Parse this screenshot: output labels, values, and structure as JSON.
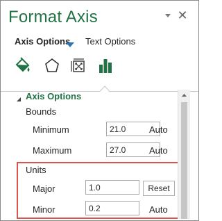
{
  "pane": {
    "title": "Format Axis",
    "close_glyph": "✕"
  },
  "tabs": [
    {
      "label": "Axis Options"
    },
    {
      "label": "Text Options"
    }
  ],
  "icons": {
    "fill": "fill-line-icon",
    "effects": "effects-icon",
    "size": "size-properties-icon",
    "axis": "axis-options-icon"
  },
  "section": {
    "title": "Axis Options"
  },
  "bounds": {
    "heading": "Bounds",
    "minimum_label": "Minimum",
    "minimum_value": "21.0",
    "minimum_auto": "Auto",
    "maximum_label": "Maximum",
    "maximum_value": "27.0",
    "maximum_auto": "Auto"
  },
  "units": {
    "heading": "Units",
    "major_label": "Major",
    "major_value": "1.0",
    "major_reset": "Reset",
    "minor_label": "Minor",
    "minor_value": "0.2",
    "minor_auto": "Auto"
  },
  "colors": {
    "accent": "#217346",
    "highlight": "#d9534f",
    "tab_arrow": "#2e75b6"
  }
}
